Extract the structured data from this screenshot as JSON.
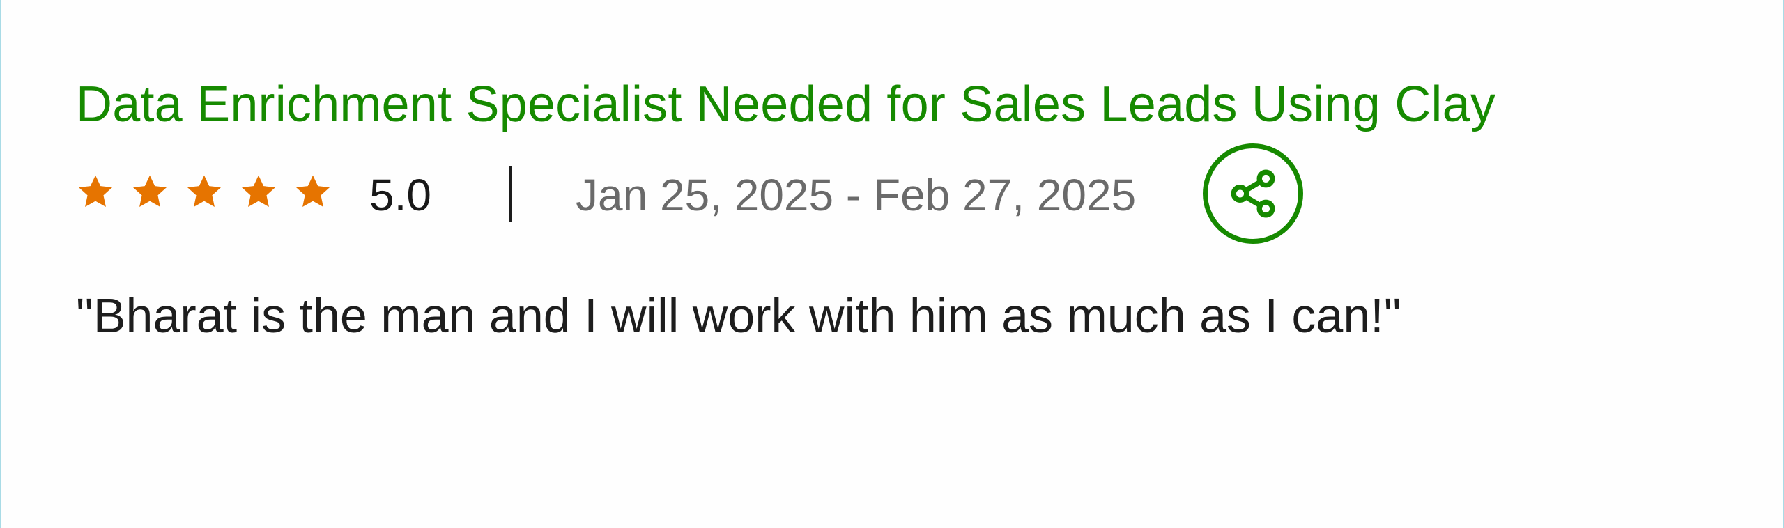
{
  "job": {
    "title": "Data Enrichment Specialist Needed for Sales Leads Using Clay"
  },
  "rating": {
    "stars": 5,
    "max_stars": 5,
    "value": "5.0",
    "star_color": "#e67400"
  },
  "dates": {
    "range": "Jan 25, 2025 - Feb 27, 2025"
  },
  "share": {
    "icon": "share-icon",
    "color": "#168a00"
  },
  "feedback": {
    "text": "\"Bharat is the man and I will work with him as much as I can!\""
  }
}
